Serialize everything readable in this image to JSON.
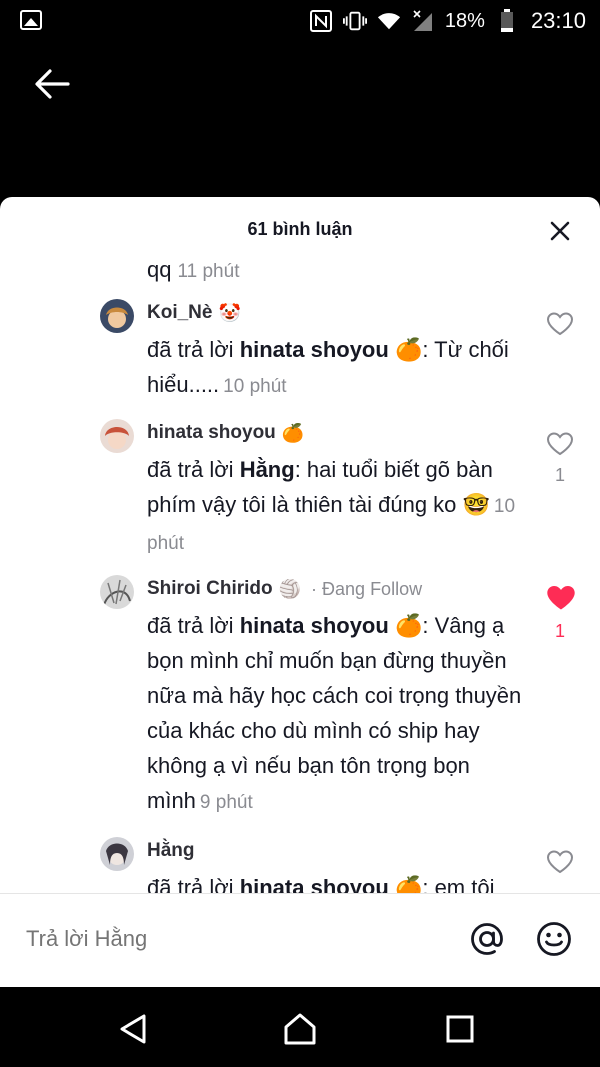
{
  "status_bar": {
    "battery": "18%",
    "time": "23:10",
    "icons": [
      "gallery-icon",
      "nfc-icon",
      "vibrate-icon",
      "wifi-icon",
      "signal-icon",
      "battery-icon"
    ]
  },
  "header": {
    "title": "61 bình luận"
  },
  "truncated_comment": {
    "text": "qq",
    "time": "11 phút"
  },
  "comments": [
    {
      "name": "Koi_Nè",
      "name_emoji": "🤡",
      "prefix": "đã trả lời ",
      "reply_to": "hinata shoyou",
      "reply_emoji": "🍊",
      "text": ": Từ chối hiểu.....",
      "time": "10 phút",
      "likes": "",
      "liked": false
    },
    {
      "name": "hinata shoyou",
      "name_emoji": "🍊",
      "prefix": "đã trả lời ",
      "reply_to": "Hằng",
      "reply_emoji": "",
      "text": ": hai tuổi biết gõ bàn phím vậy tôi là thiên tài đúng ko 🤓",
      "time": "10 phút",
      "likes": "1",
      "liked": false
    },
    {
      "name": "Shiroi Chirido",
      "name_emoji": "🏐",
      "follow_label": "Đang Follow",
      "prefix": "đã trả lời ",
      "reply_to": "hinata shoyou",
      "reply_emoji": "🍊",
      "text": ": Vâng ạ bọn mình chỉ muốn bạn đừng thuyền nữa mà hãy học cách coi trọng thuyền của khác cho dù mình có ship hay không ạ vì nếu bạn tôn trọng bọn mình",
      "time": "9 phút",
      "likes": "1",
      "liked": true
    },
    {
      "name": "Hằng",
      "name_emoji": "",
      "prefix": "đã trả lời ",
      "reply_to": "hinata shoyou",
      "reply_emoji": "🍊",
      "text": ": em tôi",
      "time": "",
      "likes": "",
      "liked": false
    }
  ],
  "input": {
    "placeholder": "Trả lời Hằng"
  },
  "colors": {
    "like_active": "#fe2c55",
    "secondary_text": "#8a8b91"
  }
}
